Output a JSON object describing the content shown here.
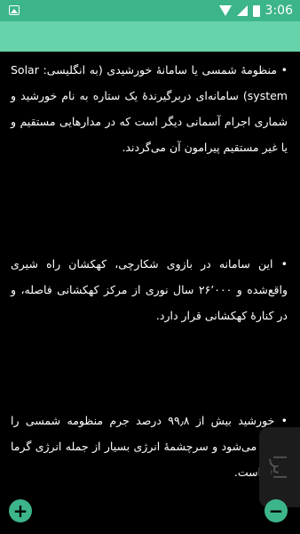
{
  "statusbar": {
    "time": "3:06",
    "icons": [
      "image-icon",
      "wifi-icon",
      "signal-icon",
      "battery-icon"
    ]
  },
  "colors": {
    "statusbar": "#3cb58a",
    "appbar": "#66d3ab",
    "background": "#000000",
    "text": "#ffffff",
    "fab": "#3cb58a"
  },
  "paragraphs": [
    "• منظومهٔ شمسی یا سامانهٔ خورشیدی (به انگلیسی: Solar system) سامانه‌ای دربرگیرندهٔ یک ستاره به نام خورشید و شماری اجرام آسمانی دیگر است که در مدارهایی مستقیم و یا غیر مستقیم پیرامون آن می‌گردند.",
    "• این سامانه در بازوی شکارچی، کهکشان راه شیری واقع‌شده و ۲۶٬۰۰۰ سال نوری از مرکز کهکشانی فاصله، و در کنارهٔ کهکشانی قرار دارد.",
    "• خورشید بیش از ۹۹٫۸ درصد جرم منظومه شمسی را شامل می‌شود و سرچشمهٔ انرژی بسیار از جمله انرژی گرما و نور است."
  ],
  "fab": {
    "add_label": "+",
    "remove_label": "−"
  },
  "watermark": "ایرا"
}
